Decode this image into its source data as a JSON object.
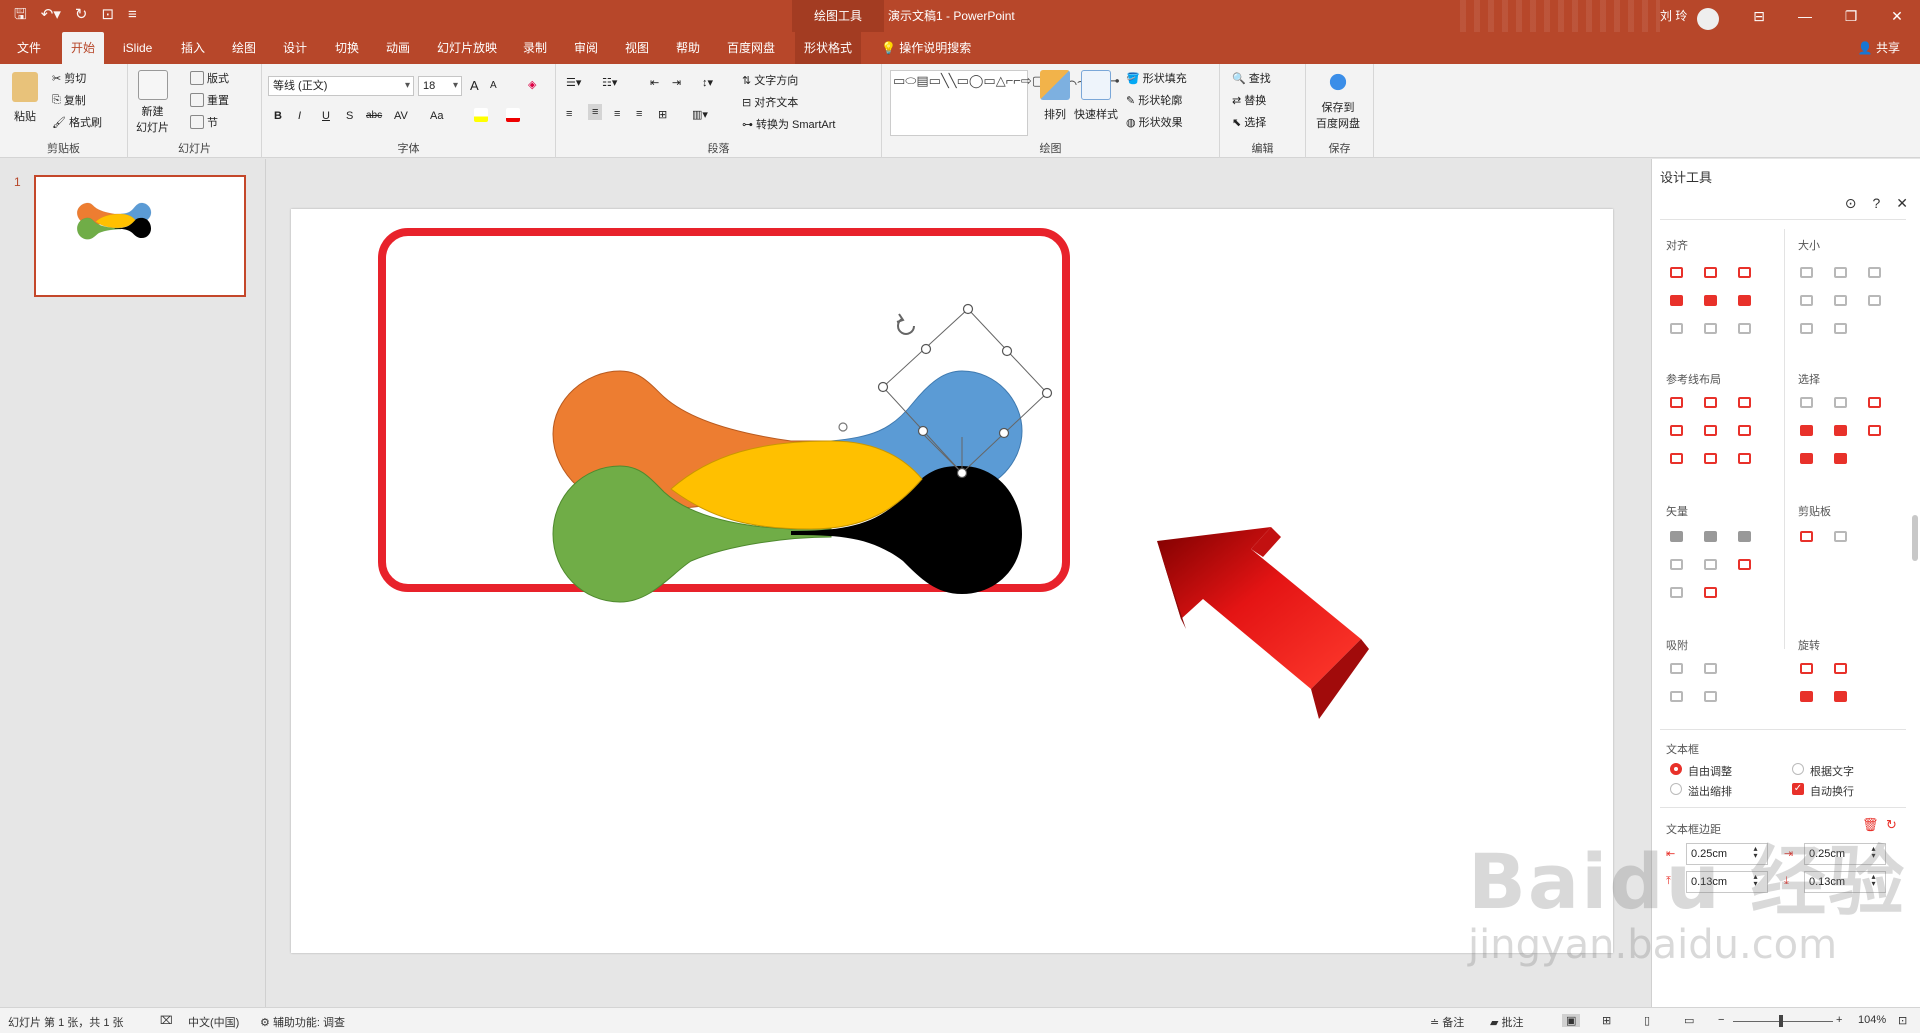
{
  "titlebar": {
    "contextual_tab": "绘图工具",
    "document_title": "演示文稿1  -  PowerPoint",
    "user_name": "刘 玲",
    "qat_icons": [
      "save-icon",
      "undo-icon",
      "redo-icon",
      "present-icon",
      "customize-icon"
    ]
  },
  "tabs": {
    "items": [
      "文件",
      "开始",
      "iSlide",
      "插入",
      "绘图",
      "设计",
      "切换",
      "动画",
      "幻灯片放映",
      "录制",
      "审阅",
      "视图",
      "帮助",
      "百度网盘",
      "形状格式"
    ],
    "active": "开始",
    "search": "操作说明搜索",
    "share": "共享"
  },
  "ribbon": {
    "clipboard": {
      "label": "剪贴板",
      "paste": "粘贴",
      "cut": "剪切",
      "copy": "复制",
      "painter": "格式刷"
    },
    "slides": {
      "label": "幻灯片",
      "new_slide": "新建",
      "new_slide2": "幻灯片",
      "layout": "版式",
      "reset": "重置",
      "section": "节"
    },
    "font": {
      "label": "字体",
      "font_name": "等线 (正文)",
      "font_size": "18",
      "bold": "B",
      "italic": "I",
      "underline": "U",
      "shadow": "S",
      "strike": "abc",
      "spacing": "AV",
      "case": "Aa",
      "grow": "A",
      "shrink": "A"
    },
    "paragraph": {
      "label": "段落",
      "text_direction": "文字方向",
      "align_text": "对齐文本",
      "smartart": "转换为 SmartArt"
    },
    "drawing": {
      "label": "绘图",
      "arrange": "排列",
      "quick_styles": "快速样式",
      "fill": "形状填充",
      "outline": "形状轮廓",
      "effects": "形状效果"
    },
    "editing": {
      "label": "编辑",
      "find": "查找",
      "replace": "替换",
      "select": "选择"
    },
    "save": {
      "label": "保存",
      "save_to": "保存到",
      "save_to2": "百度网盘"
    }
  },
  "thumbnails": {
    "slide_number": "1"
  },
  "design_pane": {
    "title": "设计工具",
    "sections": {
      "align": "对齐",
      "size": "大小",
      "guides": "参考线布局",
      "select": "选择",
      "vector": "矢量",
      "clipboard": "剪贴板",
      "snap": "吸附",
      "rotate": "旋转",
      "textbox": "文本框",
      "margins": "文本框边距"
    },
    "textbox_options": {
      "auto_adjust": "自由调整",
      "fit_text": "根据文字",
      "overflow": "溢出缩排",
      "wrap": "自动换行"
    },
    "margins": {
      "left": "0.25cm",
      "right": "0.25cm",
      "top": "0.13cm",
      "bottom": "0.13cm"
    }
  },
  "status": {
    "slide_info": "幻灯片 第 1 张，共 1 张",
    "language": "中文(中国)",
    "accessibility": "辅助功能: 调查",
    "notes": "备注",
    "comments": "批注",
    "zoom": "104%"
  },
  "watermark": {
    "line1": "Baidu 经验",
    "line2": "jingyan.baidu.com"
  },
  "colors": {
    "accent": "#b7472a",
    "orange": "#ed7d31",
    "blue": "#5b9bd5",
    "yellow": "#ffc000",
    "green": "#70ad47",
    "black": "#000000",
    "frame_red": "#e8222b",
    "arrow_red": "#e01818"
  }
}
